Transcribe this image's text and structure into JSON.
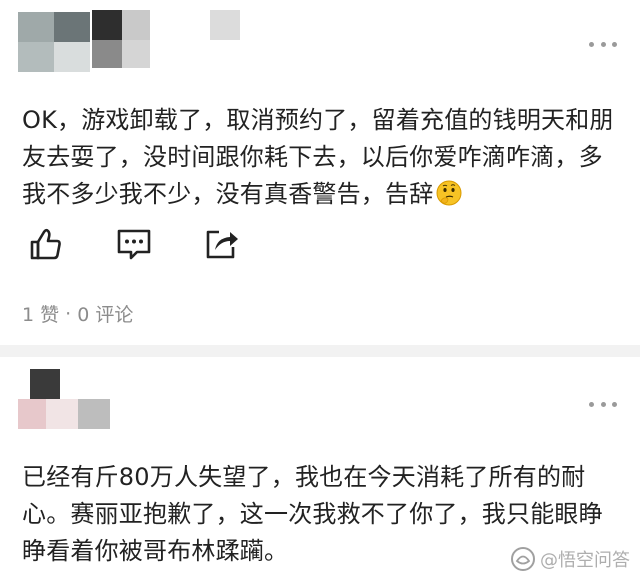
{
  "comments": [
    {
      "text": "OK，游戏卸载了，取消预约了，留着充值的钱明天和朋友去耍了，没时间跟你耗下去，以后你爱咋滴咋滴，多我不多少我不少，没有真香警告，告辞",
      "emoji": "thinking-face-emoji",
      "likes": "1 赞",
      "separator": "·",
      "replies": "0 评论"
    },
    {
      "text": "已经有斤80万人失望了，我也在今天消耗了所有的耐心。赛丽亚抱歉了，这一次我救不了你了，我只能眼睁睁看着你被哥布林蹂躏。"
    }
  ],
  "watermark": {
    "text": "@悟空问答"
  },
  "icons": {
    "like": "thumbs-up-icon",
    "comment": "comment-bubble-icon",
    "share": "share-icon",
    "more": "more-dots-icon"
  }
}
